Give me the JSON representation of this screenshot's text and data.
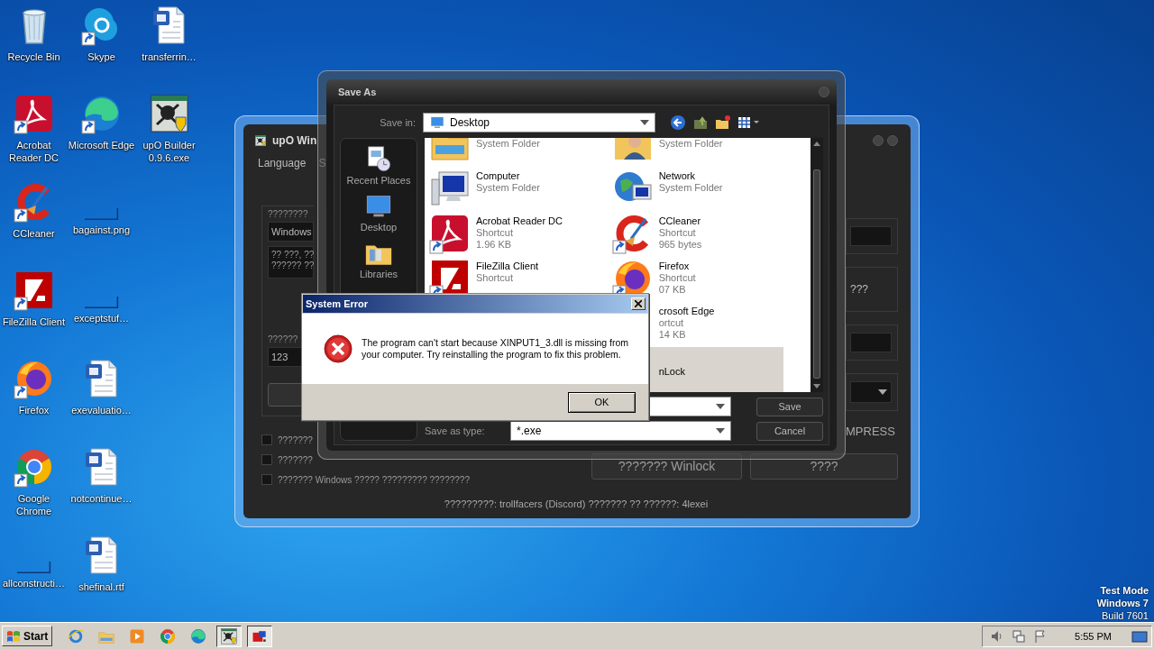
{
  "desktop": {
    "icons": [
      {
        "label": "Recycle Bin",
        "kind": "recycle"
      },
      {
        "label": "Acrobat Reader DC",
        "kind": "acrobat",
        "shortcut": true
      },
      {
        "label": "CCleaner",
        "kind": "ccleaner",
        "shortcut": true
      },
      {
        "label": "FileZilla Client",
        "kind": "filezilla",
        "shortcut": true
      },
      {
        "label": "Firefox",
        "kind": "firefox",
        "shortcut": true
      },
      {
        "label": "Google Chrome",
        "kind": "chrome",
        "shortcut": true
      },
      {
        "label": "allconstructi…",
        "kind": "blank"
      },
      {
        "label": "Skype",
        "kind": "skype",
        "shortcut": true
      },
      {
        "label": "Microsoft Edge",
        "kind": "edge",
        "shortcut": true
      },
      {
        "label": "bagainst.png",
        "kind": "blank"
      },
      {
        "label": "exceptstuf…",
        "kind": "blank"
      },
      {
        "label": "exevaluatio…",
        "kind": "word"
      },
      {
        "label": "notcontinue…",
        "kind": "word"
      },
      {
        "label": "shefinal.rtf",
        "kind": "word"
      },
      {
        "label": "transferrin…",
        "kind": "word"
      },
      {
        "label": "upO Builder 0.9.6.exe",
        "kind": "upo"
      }
    ]
  },
  "builder_window": {
    "title": "upO Win",
    "menu": [
      "Language",
      "S"
    ],
    "left": {
      "label_1": "????????",
      "field_1": "Windows",
      "text_lines": [
        "?? ???, ??",
        "?????? ??"
      ],
      "label_2": "??????",
      "field_2": "123"
    },
    "checks": [
      {
        "label": "???????",
        "checked": false
      },
      {
        "label": "???????",
        "checked": false
      },
      {
        "label": "??????? Windows ????? ????????? ????????",
        "checked": false
      }
    ],
    "right": {
      "option_label": "???",
      "mode_label": "MPRESS"
    },
    "buttons": [
      "??????? Winlock",
      "????"
    ],
    "footer": "?????????: trollfacers (Discord) ??????? ?? ??????: 4lexei"
  },
  "save_dialog": {
    "title": "Save As",
    "save_in_label": "Save in:",
    "save_in_value": "Desktop",
    "places": [
      {
        "label": "Recent Places",
        "kind": "recent"
      },
      {
        "label": "Desktop",
        "kind": "desktop"
      },
      {
        "label": "Libraries",
        "kind": "libraries"
      }
    ],
    "files": {
      "left": [
        {
          "kind": "folder",
          "lines": [
            "System Folder"
          ],
          "selected": false
        },
        {
          "kind": "computer",
          "name": "Computer",
          "lines": [
            "System Folder"
          ],
          "selected": false
        },
        {
          "kind": "acrobat",
          "name": "Acrobat Reader DC",
          "lines": [
            "Shortcut",
            "1.96 KB"
          ],
          "shortcut": true,
          "selected": false
        },
        {
          "kind": "filezilla",
          "name": "FileZilla Client",
          "lines": [
            "Shortcut"
          ],
          "shortcut": true,
          "selected": false
        }
      ],
      "right": [
        {
          "kind": "user",
          "lines": [
            "System Folder"
          ],
          "selected": false
        },
        {
          "kind": "network",
          "name": "Network",
          "lines": [
            "System Folder"
          ],
          "selected": false
        },
        {
          "kind": "ccleaner",
          "name": "CCleaner",
          "lines": [
            "Shortcut",
            "965 bytes"
          ],
          "shortcut": true,
          "selected": false
        },
        {
          "kind": "firefox",
          "name": "Firefox",
          "lines": [
            "Shortcut",
            "07 KB"
          ],
          "shortcut": true,
          "selected": false
        },
        {
          "name": "crosoft Edge",
          "lines": [
            "ortcut",
            "14 KB"
          ],
          "selected": false
        },
        {
          "name": "nLock",
          "selected": true
        }
      ]
    },
    "file_type_label": "Save as type:",
    "file_type_value": "*.exe",
    "buttons": [
      "Save",
      "Cancel"
    ]
  },
  "error_dialog": {
    "title": "System Error",
    "message": "The program can't start because XINPUT1_3.dll is missing from your computer. Try reinstalling the program to fix this problem.",
    "button": "OK"
  },
  "system_info": [
    "Test Mode",
    "Windows 7",
    "Build 7601"
  ],
  "taskbar": {
    "start": "Start",
    "apps": [
      {
        "kind": "ie",
        "active": false
      },
      {
        "kind": "explorer",
        "active": false
      },
      {
        "kind": "media",
        "active": false
      },
      {
        "kind": "chrome",
        "active": false
      },
      {
        "kind": "edge",
        "active": false
      },
      {
        "kind": "upo",
        "active": true
      },
      {
        "kind": "savedlg",
        "active": true
      }
    ],
    "clock": "5:55 PM"
  }
}
